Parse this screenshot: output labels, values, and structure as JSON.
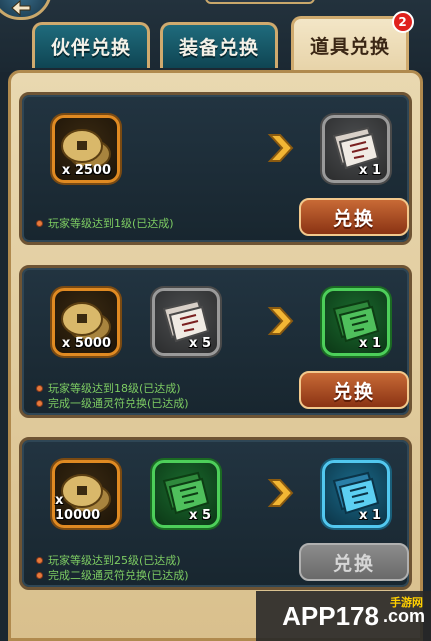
{
  "tabs": [
    {
      "label": "伙伴兑换",
      "active": false
    },
    {
      "label": "装备兑换",
      "active": false
    },
    {
      "label": "道具兑换",
      "active": true,
      "badge": "2"
    }
  ],
  "exchanges": [
    {
      "inputs": [
        {
          "type": "coin",
          "quantity": "x 2500"
        }
      ],
      "output": {
        "type": "gray-talisman",
        "quantity": "x 1"
      },
      "requirements": [
        "玩家等级达到1级(已达成)"
      ],
      "button_label": "兑换",
      "button_enabled": true
    },
    {
      "inputs": [
        {
          "type": "coin",
          "quantity": "x 5000"
        },
        {
          "type": "gray-talisman",
          "quantity": "x 5"
        }
      ],
      "output": {
        "type": "green-talisman",
        "quantity": "x 1"
      },
      "requirements": [
        "玩家等级达到18级(已达成)",
        "完成一级通灵符兑换(已达成)"
      ],
      "button_label": "兑换",
      "button_enabled": true
    },
    {
      "inputs": [
        {
          "type": "coin",
          "quantity": "x 10000"
        },
        {
          "type": "green-talisman",
          "quantity": "x 5"
        }
      ],
      "output": {
        "type": "blue-talisman",
        "quantity": "x 1"
      },
      "requirements": [
        "玩家等级达到25级(已达成)",
        "完成二级通灵符兑换(已达成)"
      ],
      "button_label": "兑换",
      "button_enabled": false
    }
  ],
  "watermark": {
    "text": "APP178",
    "suffix": ".com",
    "sub": "手游网"
  },
  "colors": {
    "accent_gold": "#cfaa6e",
    "requirement_green": "#7dcc63",
    "button_orange": "#c86a36"
  }
}
